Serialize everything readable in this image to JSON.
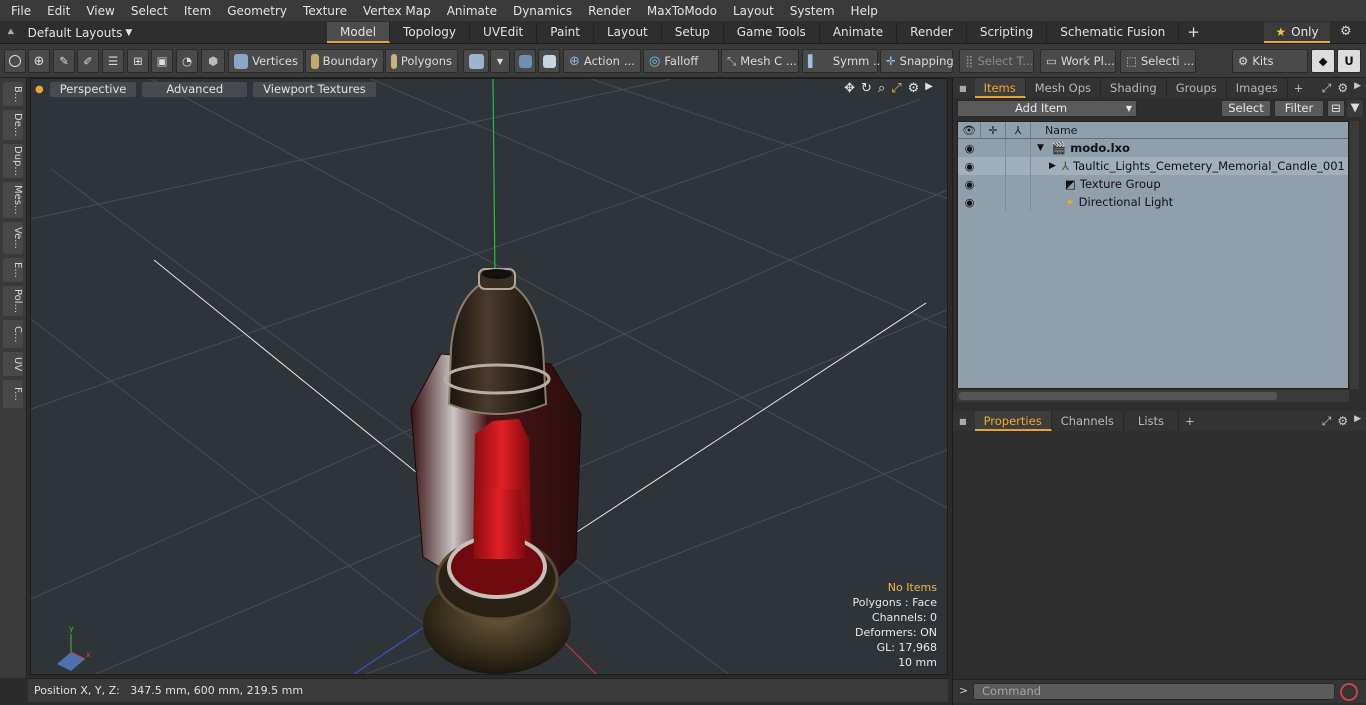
{
  "menu": [
    "File",
    "Edit",
    "View",
    "Select",
    "Item",
    "Geometry",
    "Texture",
    "Vertex Map",
    "Animate",
    "Dynamics",
    "Render",
    "MaxToModo",
    "Layout",
    "System",
    "Help"
  ],
  "layouts": {
    "label": "Default Layouts"
  },
  "tabs": [
    "Model",
    "Topology",
    "UVEdit",
    "Paint",
    "Layout",
    "Setup",
    "Game Tools",
    "Animate",
    "Render",
    "Scripting",
    "Schematic Fusion"
  ],
  "active_tab": "Model",
  "only_label": "Only",
  "toolbar": {
    "vertices": "Vertices",
    "boundary": "Boundary",
    "polygons": "Polygons",
    "action": "Action",
    "falloff": "Falloff",
    "mesh": "Mesh C ...",
    "symm": "Symm ...",
    "snapping": "Snapping",
    "select_t": "Select T...",
    "work": "Work Pl...",
    "selecti": "Selecti ...",
    "kits": "Kits"
  },
  "left_strip": [
    "B...",
    "De...",
    "Dup...",
    "Mes...",
    "Ve...",
    "E...",
    "Pol...",
    "C...",
    "UV",
    "F..."
  ],
  "viewport": {
    "buttons": [
      "Perspective",
      "Advanced",
      "Viewport Textures"
    ],
    "info": {
      "no_items": "No Items",
      "polygons": "Polygons : Face",
      "channels": "Channels: 0",
      "deformers": "Deformers: ON",
      "gl": "GL: 17,968",
      "scale": "10 mm"
    }
  },
  "status": {
    "position": "Position X, Y, Z:   347.5 mm, 600 mm, 219.5 mm"
  },
  "items_panel": {
    "tabs": [
      "Items",
      "Mesh Ops",
      "Shading",
      "Groups",
      "Images"
    ],
    "add_item": "Add Item",
    "select": "Select",
    "filter": "Filter",
    "column_name": "Name",
    "tree": [
      {
        "label": "modo.lxo",
        "icon": "scene-icon"
      },
      {
        "label": "Taultic_Lights_Cemetery_Memorial_Candle_001",
        "icon": "mesh-icon"
      },
      {
        "label": "Texture Group",
        "icon": "texture-icon"
      },
      {
        "label": "Directional Light",
        "icon": "light-icon"
      }
    ]
  },
  "props_panel": {
    "tabs": [
      "Properties",
      "Channels",
      "Lists"
    ]
  },
  "command": {
    "placeholder": "Command"
  },
  "colors": {
    "accent": "#e8a23a",
    "viewport_bg": "#2f3439",
    "item_list_bg": "#8f9fac"
  }
}
